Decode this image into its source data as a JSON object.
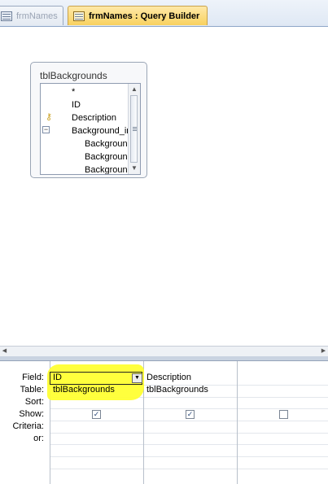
{
  "tabs": [
    {
      "label": "frmNames",
      "active": false
    },
    {
      "label": "frmNames : Query Builder",
      "active": true
    }
  ],
  "table": {
    "title": "tblBackgrounds",
    "fields": [
      "*",
      "ID",
      "Description",
      "Background_im",
      "Background",
      "Background",
      "Background"
    ]
  },
  "grid": {
    "row_labels": [
      "Field:",
      "Table:",
      "Sort:",
      "Show:",
      "Criteria:",
      "or:"
    ],
    "columns": [
      {
        "field": "ID",
        "table": "tblBackgrounds",
        "show": true
      },
      {
        "field": "Description",
        "table": "tblBackgrounds",
        "show": true
      },
      {
        "field": "",
        "table": "",
        "show": false
      }
    ]
  },
  "colors": {
    "highlight": "#ffff33",
    "active_tab": "#f8d15f"
  }
}
